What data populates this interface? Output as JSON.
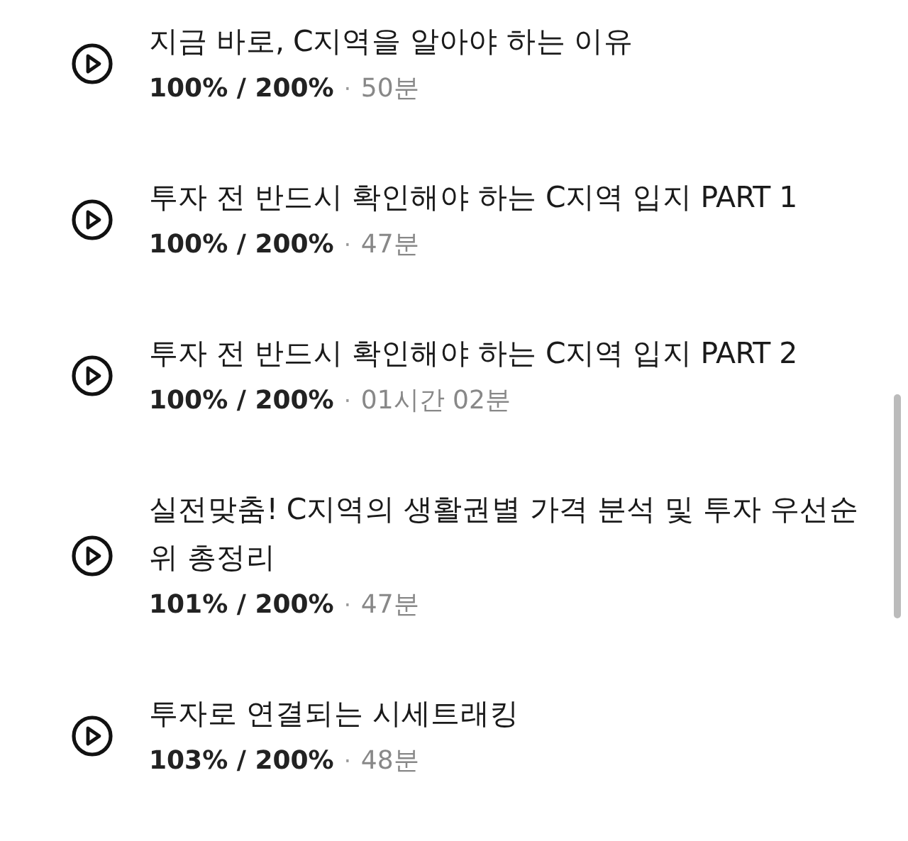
{
  "lessons": [
    {
      "title": "지금 바로, C지역을 알아야 하는 이유",
      "progress": "100% / 200%",
      "separator": "·",
      "duration": "50분"
    },
    {
      "title": "투자 전 반드시 확인해야 하는 C지역 입지 PART 1",
      "progress": "100% / 200%",
      "separator": "·",
      "duration": "47분"
    },
    {
      "title": "투자 전 반드시 확인해야 하는 C지역 입지 PART 2",
      "progress": "100% / 200%",
      "separator": "·",
      "duration": "01시간 02분"
    },
    {
      "title": "실전맞춤! C지역의 생활권별 가격 분석 및 투자 우선순위 총정리",
      "progress": "101% / 200%",
      "separator": "·",
      "duration": "47분"
    },
    {
      "title": "투자로 연결되는 시세트래킹",
      "progress": "103% / 200%",
      "separator": "·",
      "duration": "48분"
    }
  ]
}
